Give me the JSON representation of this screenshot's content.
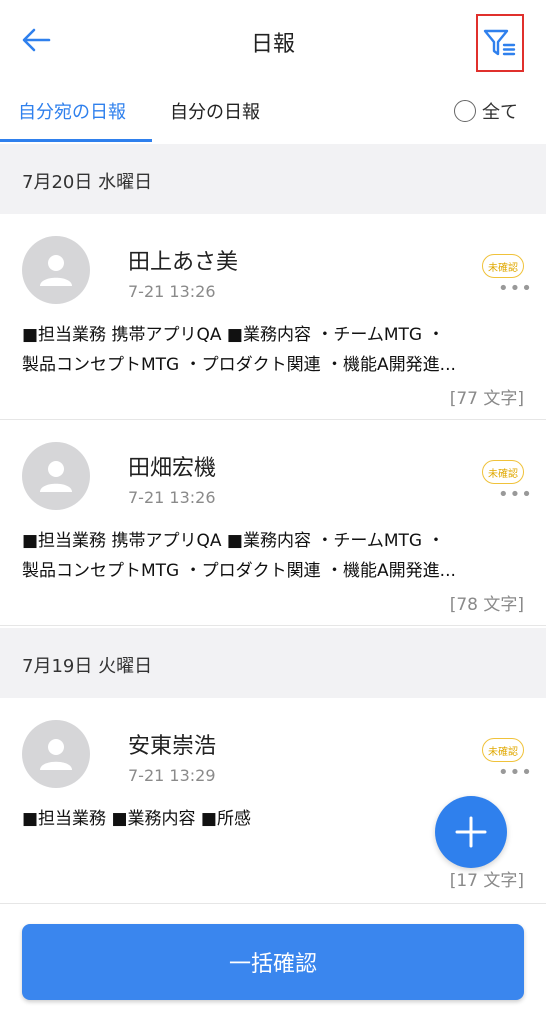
{
  "header": {
    "title": "日報",
    "back_icon": "arrow-left-icon",
    "filter_icon": "filter-icon"
  },
  "tabs": [
    {
      "label": "自分宛の日報",
      "active": true
    },
    {
      "label": "自分の日報",
      "active": false
    }
  ],
  "all_toggle": {
    "label": "全て",
    "checked": false
  },
  "groups": [
    {
      "date": "7月20日 水曜日",
      "reports": [
        {
          "name": "田上あさ美",
          "time": "7-21 13:26",
          "status": "未確認",
          "line1": "■担当業務 携帯アプリQA ■業務内容 ・チームMTG ・",
          "line2": "製品コンセプトMTG ・プロダクト関連 ・機能A開発進...",
          "count": "[77 文字]"
        },
        {
          "name": "田畑宏機",
          "time": "7-21 13:26",
          "status": "未確認",
          "line1": "■担当業務 携帯アプリQA ■業務内容 ・チームMTG ・",
          "line2": "製品コンセプトMTG ・プロダクト関連 ・機能A開発進...",
          "count": "[78 文字]"
        }
      ]
    },
    {
      "date": "7月19日 火曜日",
      "reports": [
        {
          "name": "安東崇浩",
          "time": "7-21 13:29",
          "status": "未確認",
          "line1": "■担当業務 ■業務内容 ■所感",
          "count": "[17 文字]"
        }
      ]
    }
  ],
  "fab": {
    "icon": "plus-icon"
  },
  "bottom": {
    "confirm_label": "一括確認"
  },
  "colors": {
    "accent": "#2f80ed",
    "badge": "#f0c23a",
    "highlight_border": "#e0302c"
  }
}
